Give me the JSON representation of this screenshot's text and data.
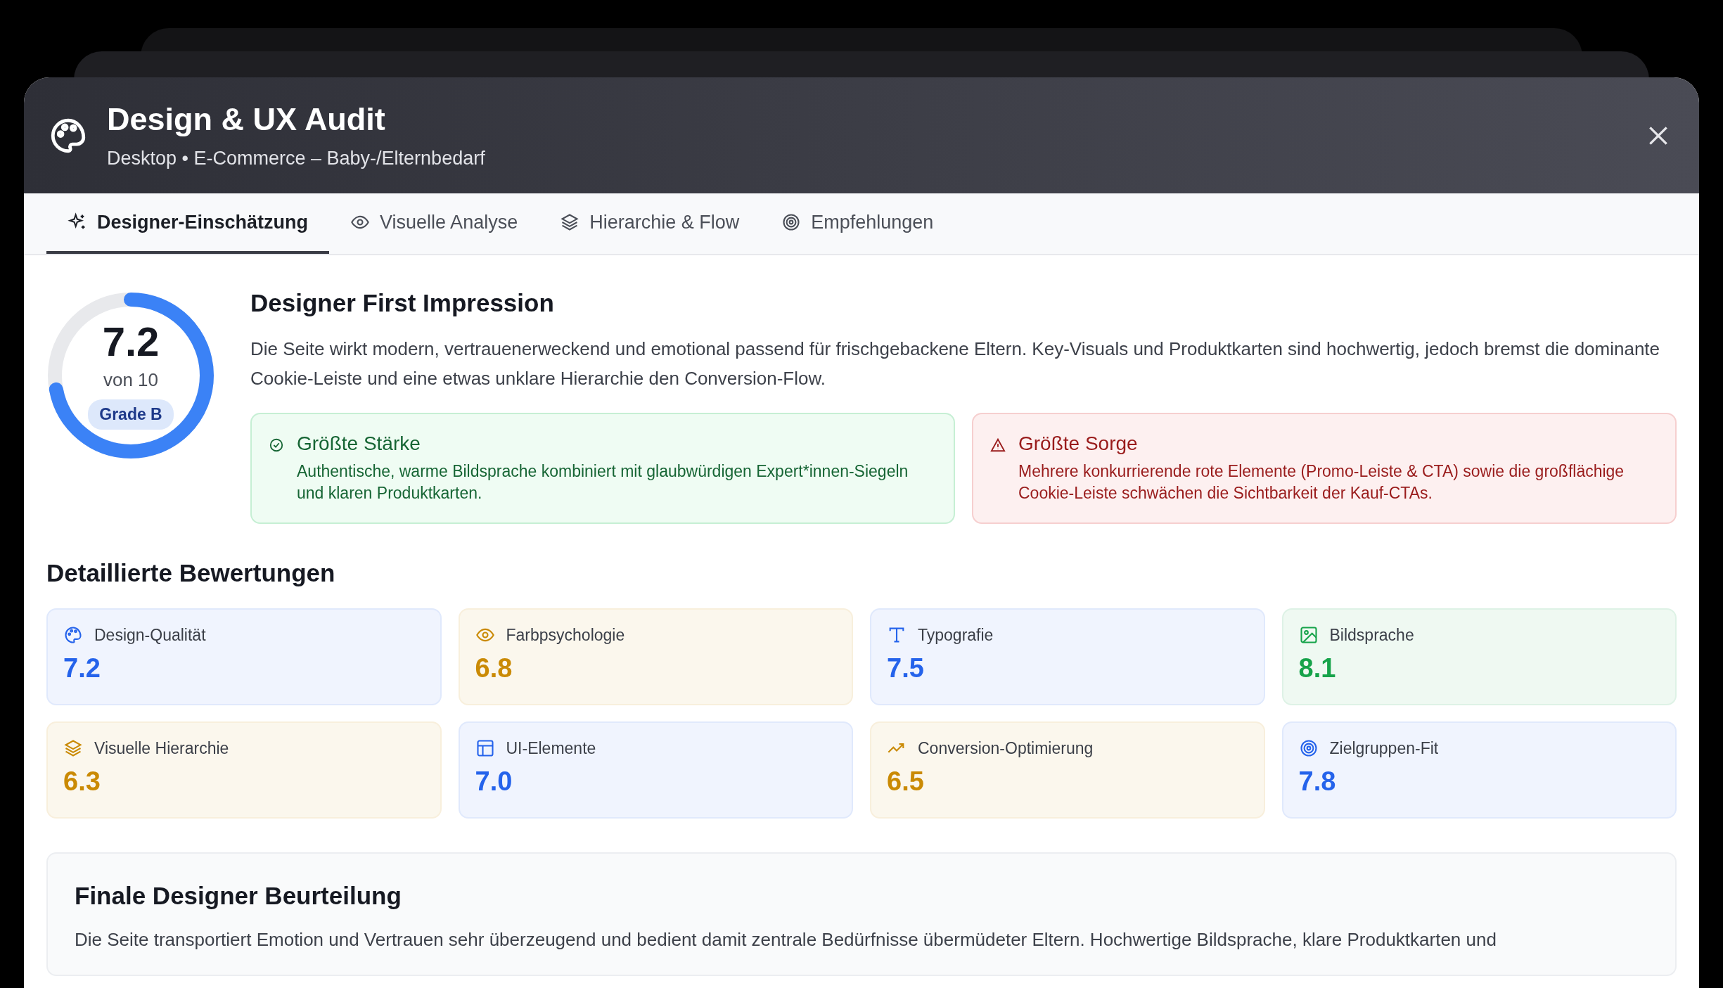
{
  "window": {
    "title": "Design & UX Audit",
    "subtitle": "Desktop • E-Commerce – Baby-/Elternbedarf"
  },
  "tabs": [
    {
      "label": "Designer-Einschätzung",
      "kind": "sparkles",
      "selected": true
    },
    {
      "label": "Visuelle Analyse",
      "kind": "eye",
      "selected": false
    },
    {
      "label": "Hierarchie & Flow",
      "kind": "layers",
      "selected": false
    },
    {
      "label": "Empfehlungen",
      "kind": "target",
      "selected": false
    }
  ],
  "score": {
    "value": "7.2",
    "scale": "von 10",
    "grade": "Grade B",
    "level": 0.72
  },
  "impression": {
    "title": "Designer First Impression",
    "text": "Die Seite wirkt modern, vertrauenerweckend und emotional passend für frischgebackene Eltern. Key-Visuals und Produktkarten sind hochwertig, jedoch bremst die dominante Cookie-Leiste und eine etwas unklare Hierarchie den Conversion-Flow."
  },
  "highlights": [
    {
      "kind": "strength",
      "title": "Größte Stärke",
      "text": "Authentische, warme Bildsprache kombiniert mit glaubwürdigen Expert*innen-Siegeln und klaren Produktkarten."
    },
    {
      "kind": "concern",
      "title": "Größte Sorge",
      "text": "Mehrere konkurrierende rote Elemente (Promo-Leiste & CTA) sowie die großflächige Cookie-Leiste schwächen die Sichtbarkeit der Kauf-CTAs."
    }
  ],
  "ratings_title": "Detaillierte Bewertungen",
  "ratings": [
    {
      "label": "Design-Qualität",
      "value": "7.2",
      "kind": "palette",
      "color": "#2563eb"
    },
    {
      "label": "Farbpsychologie",
      "value": "6.8",
      "kind": "eye",
      "color": "#ca8a04"
    },
    {
      "label": "Typografie",
      "value": "7.5",
      "kind": "type",
      "color": "#2563eb"
    },
    {
      "label": "Bildsprache",
      "value": "8.1",
      "kind": "image",
      "color": "#16a34a"
    },
    {
      "label": "Visuelle Hierarchie",
      "value": "6.3",
      "kind": "layers",
      "color": "#ca8a04"
    },
    {
      "label": "UI-Elemente",
      "value": "7.0",
      "kind": "layout",
      "color": "#2563eb"
    },
    {
      "label": "Conversion-Optimierung",
      "value": "6.5",
      "kind": "trend",
      "color": "#ca8a04"
    },
    {
      "label": "Zielgruppen-Fit",
      "value": "7.8",
      "kind": "target",
      "color": "#2563eb"
    }
  ],
  "final": {
    "title": "Finale Designer Beurteilung",
    "text": "Die Seite transportiert Emotion und Vertrauen sehr überzeugend und bedient damit zentrale Bedürfnisse übermüdeter Eltern. Hochwertige Bildsprache, klare Produktkarten und"
  }
}
